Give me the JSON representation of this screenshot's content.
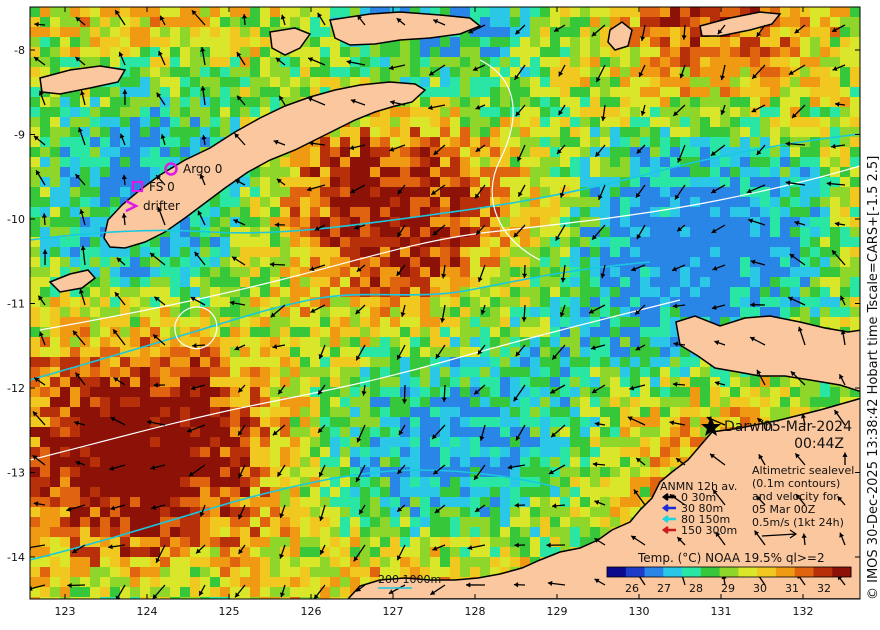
{
  "map": {
    "lon_ticks": [
      "123",
      "124",
      "125",
      "126",
      "127",
      "128",
      "129",
      "130",
      "131",
      "132"
    ],
    "lat_ticks": [
      "-8",
      "-9",
      "-10",
      "-11",
      "-12",
      "-13",
      "-14"
    ]
  },
  "legend_markers": {
    "argo": "Argo 0",
    "fs": "FS 0",
    "drifter": "drifter"
  },
  "place": {
    "darwin": "Darwin"
  },
  "date": {
    "date": "05-Mar-2024",
    "time": "00:44Z"
  },
  "anmn": {
    "title": "ANMN 12h av.",
    "rows": [
      {
        "label": "0 30m",
        "color": "#000000"
      },
      {
        "label": "30 80m",
        "color": "#1a2bd6"
      },
      {
        "label": "80 150m",
        "color": "#19d6e0"
      },
      {
        "label": "150 300m",
        "color": "#cc1a1a"
      }
    ]
  },
  "altimetry": {
    "lines": [
      "Altimetric sealevel",
      "(0.1m contours)",
      "and velocity for",
      "05 Mar 00Z",
      "0.5m/s (1kt 24h)"
    ]
  },
  "isobath_label": "200  1000m",
  "colorbar": {
    "title": "Temp. (°C) NOAA 19.5% ql>=2",
    "ticks": [
      "26",
      "27",
      "28",
      "29",
      "30",
      "31",
      "32"
    ],
    "colors": [
      "#0a0a8c",
      "#1f3cc8",
      "#2a86e6",
      "#2ac8e6",
      "#2ae6a4",
      "#36c83a",
      "#8ed629",
      "#d9e629",
      "#f0c81f",
      "#f09a14",
      "#e0640f",
      "#b8300a",
      "#8c1208"
    ]
  },
  "credit": "© IMOS 30-Dec-2025 13:38:42 Hobart time Tscale=CARS+[-1.5 2.5]"
}
